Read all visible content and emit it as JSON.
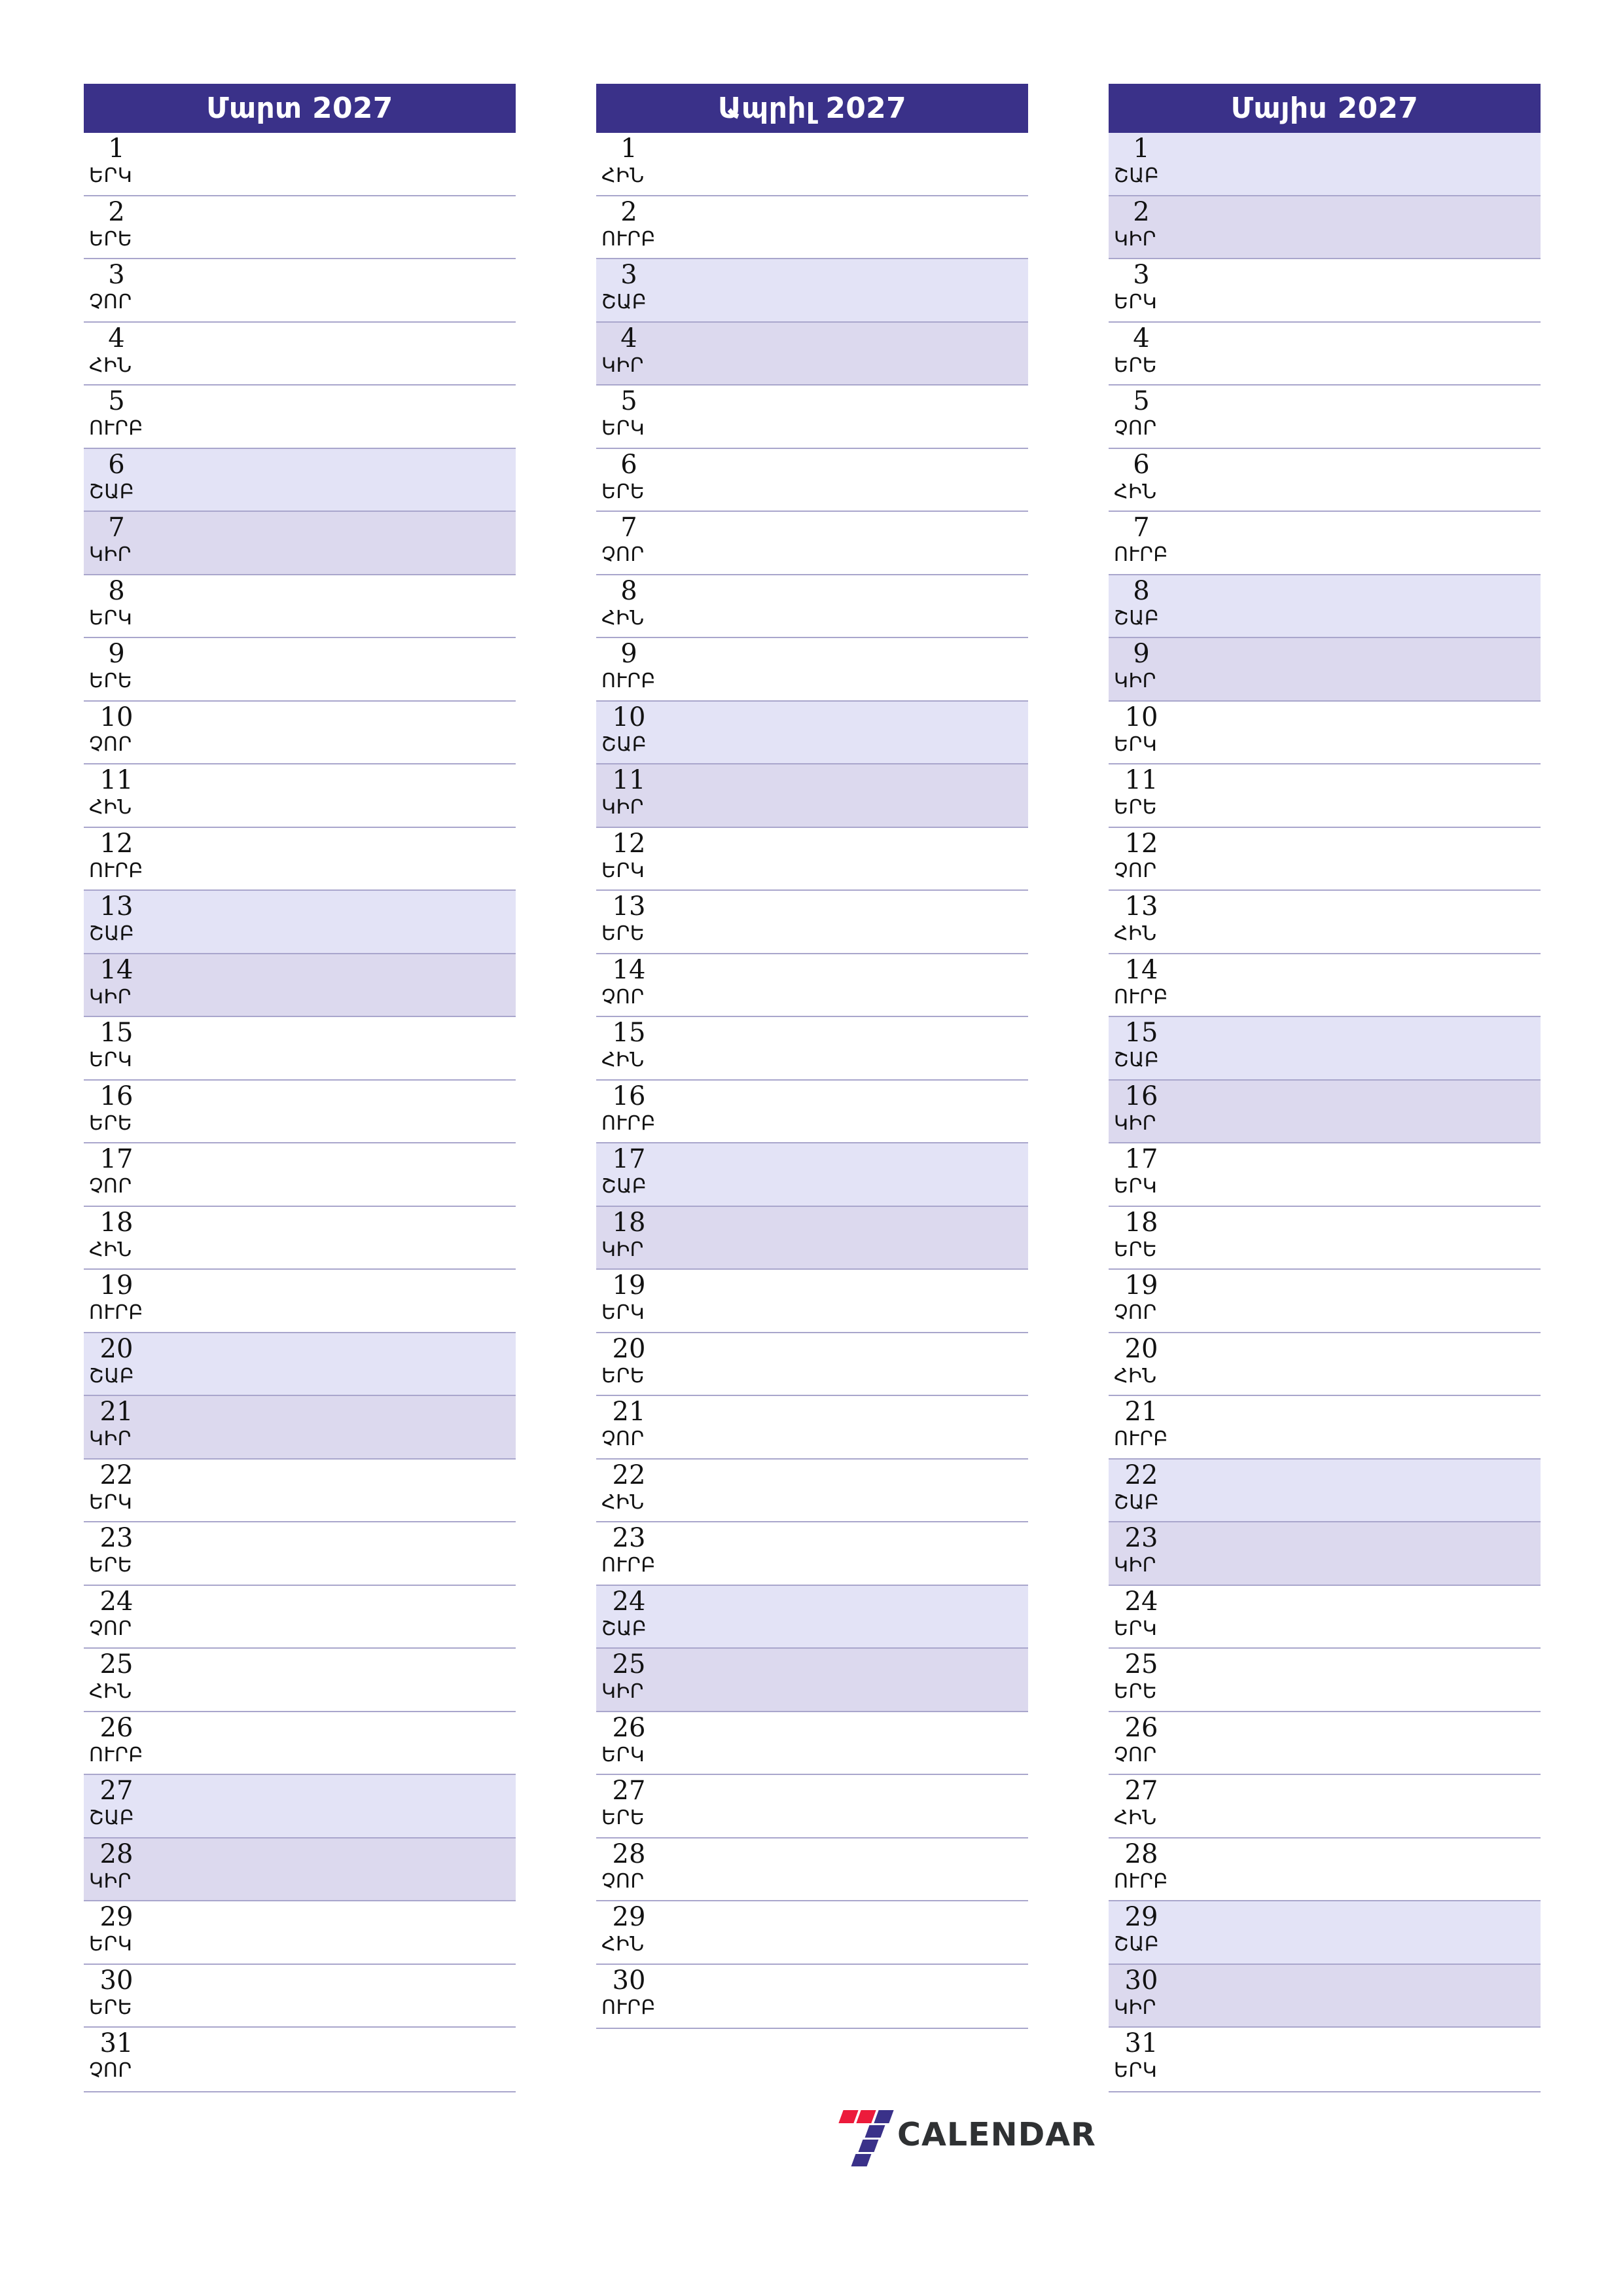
{
  "document": {
    "type": "monthly-planner",
    "year": "2027",
    "language": "Armenian"
  },
  "colors": {
    "header_bg": "#3a3189",
    "header_text": "#ffffff",
    "saturday_bg": "#e3e3f6",
    "sunday_bg": "#dcd9ee",
    "row_border": "#a9a6cc",
    "text": "#121212",
    "logo_red": "#ec1b3b",
    "logo_blue": "#3a3189",
    "logo_text": "#2f3133"
  },
  "weekday_abbr": {
    "mon": "ԵՐԿ",
    "tue": "ԵՐԵ",
    "wed": "ՉՈՐ",
    "thu": "ՀԻՆ",
    "fri": "ՈՒՐԲ",
    "sat": "ՇԱԲ",
    "sun": "ԿԻՐ"
  },
  "months": [
    {
      "title": "Մարտ 2027",
      "name": "Մարտ",
      "year": "2027",
      "days": [
        {
          "num": "1",
          "abbr": "ԵՐԿ",
          "kind": "weekday"
        },
        {
          "num": "2",
          "abbr": "ԵՐԵ",
          "kind": "weekday"
        },
        {
          "num": "3",
          "abbr": "ՉՈՐ",
          "kind": "weekday"
        },
        {
          "num": "4",
          "abbr": "ՀԻՆ",
          "kind": "weekday"
        },
        {
          "num": "5",
          "abbr": "ՈՒՐԲ",
          "kind": "weekday"
        },
        {
          "num": "6",
          "abbr": "ՇԱԲ",
          "kind": "sat"
        },
        {
          "num": "7",
          "abbr": "ԿԻՐ",
          "kind": "sun"
        },
        {
          "num": "8",
          "abbr": "ԵՐԿ",
          "kind": "weekday"
        },
        {
          "num": "9",
          "abbr": "ԵՐԵ",
          "kind": "weekday"
        },
        {
          "num": "10",
          "abbr": "ՉՈՐ",
          "kind": "weekday"
        },
        {
          "num": "11",
          "abbr": "ՀԻՆ",
          "kind": "weekday"
        },
        {
          "num": "12",
          "abbr": "ՈՒՐԲ",
          "kind": "weekday"
        },
        {
          "num": "13",
          "abbr": "ՇԱԲ",
          "kind": "sat"
        },
        {
          "num": "14",
          "abbr": "ԿԻՐ",
          "kind": "sun"
        },
        {
          "num": "15",
          "abbr": "ԵՐԿ",
          "kind": "weekday"
        },
        {
          "num": "16",
          "abbr": "ԵՐԵ",
          "kind": "weekday"
        },
        {
          "num": "17",
          "abbr": "ՉՈՐ",
          "kind": "weekday"
        },
        {
          "num": "18",
          "abbr": "ՀԻՆ",
          "kind": "weekday"
        },
        {
          "num": "19",
          "abbr": "ՈՒՐԲ",
          "kind": "weekday"
        },
        {
          "num": "20",
          "abbr": "ՇԱԲ",
          "kind": "sat"
        },
        {
          "num": "21",
          "abbr": "ԿԻՐ",
          "kind": "sun"
        },
        {
          "num": "22",
          "abbr": "ԵՐԿ",
          "kind": "weekday"
        },
        {
          "num": "23",
          "abbr": "ԵՐԵ",
          "kind": "weekday"
        },
        {
          "num": "24",
          "abbr": "ՉՈՐ",
          "kind": "weekday"
        },
        {
          "num": "25",
          "abbr": "ՀԻՆ",
          "kind": "weekday"
        },
        {
          "num": "26",
          "abbr": "ՈՒՐԲ",
          "kind": "weekday"
        },
        {
          "num": "27",
          "abbr": "ՇԱԲ",
          "kind": "sat"
        },
        {
          "num": "28",
          "abbr": "ԿԻՐ",
          "kind": "sun"
        },
        {
          "num": "29",
          "abbr": "ԵՐԿ",
          "kind": "weekday"
        },
        {
          "num": "30",
          "abbr": "ԵՐԵ",
          "kind": "weekday"
        },
        {
          "num": "31",
          "abbr": "ՉՈՐ",
          "kind": "weekday"
        }
      ]
    },
    {
      "title": "Ապրիլ 2027",
      "name": "Ապրիլ",
      "year": "2027",
      "days": [
        {
          "num": "1",
          "abbr": "ՀԻՆ",
          "kind": "weekday"
        },
        {
          "num": "2",
          "abbr": "ՈՒՐԲ",
          "kind": "weekday"
        },
        {
          "num": "3",
          "abbr": "ՇԱԲ",
          "kind": "sat"
        },
        {
          "num": "4",
          "abbr": "ԿԻՐ",
          "kind": "sun"
        },
        {
          "num": "5",
          "abbr": "ԵՐԿ",
          "kind": "weekday"
        },
        {
          "num": "6",
          "abbr": "ԵՐԵ",
          "kind": "weekday"
        },
        {
          "num": "7",
          "abbr": "ՉՈՐ",
          "kind": "weekday"
        },
        {
          "num": "8",
          "abbr": "ՀԻՆ",
          "kind": "weekday"
        },
        {
          "num": "9",
          "abbr": "ՈՒՐԲ",
          "kind": "weekday"
        },
        {
          "num": "10",
          "abbr": "ՇԱԲ",
          "kind": "sat"
        },
        {
          "num": "11",
          "abbr": "ԿԻՐ",
          "kind": "sun"
        },
        {
          "num": "12",
          "abbr": "ԵՐԿ",
          "kind": "weekday"
        },
        {
          "num": "13",
          "abbr": "ԵՐԵ",
          "kind": "weekday"
        },
        {
          "num": "14",
          "abbr": "ՉՈՐ",
          "kind": "weekday"
        },
        {
          "num": "15",
          "abbr": "ՀԻՆ",
          "kind": "weekday"
        },
        {
          "num": "16",
          "abbr": "ՈՒՐԲ",
          "kind": "weekday"
        },
        {
          "num": "17",
          "abbr": "ՇԱԲ",
          "kind": "sat"
        },
        {
          "num": "18",
          "abbr": "ԿԻՐ",
          "kind": "sun"
        },
        {
          "num": "19",
          "abbr": "ԵՐԿ",
          "kind": "weekday"
        },
        {
          "num": "20",
          "abbr": "ԵՐԵ",
          "kind": "weekday"
        },
        {
          "num": "21",
          "abbr": "ՉՈՐ",
          "kind": "weekday"
        },
        {
          "num": "22",
          "abbr": "ՀԻՆ",
          "kind": "weekday"
        },
        {
          "num": "23",
          "abbr": "ՈՒՐԲ",
          "kind": "weekday"
        },
        {
          "num": "24",
          "abbr": "ՇԱԲ",
          "kind": "sat"
        },
        {
          "num": "25",
          "abbr": "ԿԻՐ",
          "kind": "sun"
        },
        {
          "num": "26",
          "abbr": "ԵՐԿ",
          "kind": "weekday"
        },
        {
          "num": "27",
          "abbr": "ԵՐԵ",
          "kind": "weekday"
        },
        {
          "num": "28",
          "abbr": "ՉՈՐ",
          "kind": "weekday"
        },
        {
          "num": "29",
          "abbr": "ՀԻՆ",
          "kind": "weekday"
        },
        {
          "num": "30",
          "abbr": "ՈՒՐԲ",
          "kind": "weekday"
        }
      ]
    },
    {
      "title": "Մայիս 2027",
      "name": "Մայիս",
      "year": "2027",
      "days": [
        {
          "num": "1",
          "abbr": "ՇԱԲ",
          "kind": "sat"
        },
        {
          "num": "2",
          "abbr": "ԿԻՐ",
          "kind": "sun"
        },
        {
          "num": "3",
          "abbr": "ԵՐԿ",
          "kind": "weekday"
        },
        {
          "num": "4",
          "abbr": "ԵՐԵ",
          "kind": "weekday"
        },
        {
          "num": "5",
          "abbr": "ՉՈՐ",
          "kind": "weekday"
        },
        {
          "num": "6",
          "abbr": "ՀԻՆ",
          "kind": "weekday"
        },
        {
          "num": "7",
          "abbr": "ՈՒՐԲ",
          "kind": "weekday"
        },
        {
          "num": "8",
          "abbr": "ՇԱԲ",
          "kind": "sat"
        },
        {
          "num": "9",
          "abbr": "ԿԻՐ",
          "kind": "sun"
        },
        {
          "num": "10",
          "abbr": "ԵՐԿ",
          "kind": "weekday"
        },
        {
          "num": "11",
          "abbr": "ԵՐԵ",
          "kind": "weekday"
        },
        {
          "num": "12",
          "abbr": "ՉՈՐ",
          "kind": "weekday"
        },
        {
          "num": "13",
          "abbr": "ՀԻՆ",
          "kind": "weekday"
        },
        {
          "num": "14",
          "abbr": "ՈՒՐԲ",
          "kind": "weekday"
        },
        {
          "num": "15",
          "abbr": "ՇԱԲ",
          "kind": "sat"
        },
        {
          "num": "16",
          "abbr": "ԿԻՐ",
          "kind": "sun"
        },
        {
          "num": "17",
          "abbr": "ԵՐԿ",
          "kind": "weekday"
        },
        {
          "num": "18",
          "abbr": "ԵՐԵ",
          "kind": "weekday"
        },
        {
          "num": "19",
          "abbr": "ՉՈՐ",
          "kind": "weekday"
        },
        {
          "num": "20",
          "abbr": "ՀԻՆ",
          "kind": "weekday"
        },
        {
          "num": "21",
          "abbr": "ՈՒՐԲ",
          "kind": "weekday"
        },
        {
          "num": "22",
          "abbr": "ՇԱԲ",
          "kind": "sat"
        },
        {
          "num": "23",
          "abbr": "ԿԻՐ",
          "kind": "sun"
        },
        {
          "num": "24",
          "abbr": "ԵՐԿ",
          "kind": "weekday"
        },
        {
          "num": "25",
          "abbr": "ԵՐԵ",
          "kind": "weekday"
        },
        {
          "num": "26",
          "abbr": "ՉՈՐ",
          "kind": "weekday"
        },
        {
          "num": "27",
          "abbr": "ՀԻՆ",
          "kind": "weekday"
        },
        {
          "num": "28",
          "abbr": "ՈՒՐԲ",
          "kind": "weekday"
        },
        {
          "num": "29",
          "abbr": "ՇԱԲ",
          "kind": "sat"
        },
        {
          "num": "30",
          "abbr": "ԿԻՐ",
          "kind": "sun"
        },
        {
          "num": "31",
          "abbr": "ԵՐԿ",
          "kind": "weekday"
        }
      ]
    }
  ],
  "logo": {
    "text": "CALENDAR",
    "mark": "seven-mark"
  }
}
